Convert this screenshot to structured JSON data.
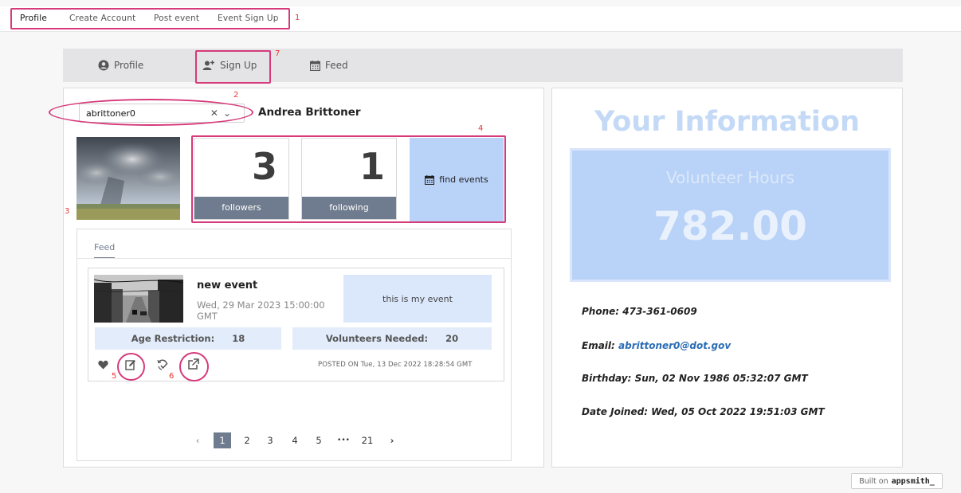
{
  "topnav": {
    "items": [
      "Profile",
      "Create Account",
      "Post event",
      "Event Sign Up"
    ],
    "active": "Profile"
  },
  "tabs": [
    "Profile",
    "Sign Up",
    "Feed"
  ],
  "user": {
    "select_value": "abrittoner0",
    "name": "Andrea Brittoner"
  },
  "stats": {
    "followers_count": "3",
    "followers_label": "followers",
    "following_count": "1",
    "following_label": "following",
    "find_events_label": "find events"
  },
  "feed": {
    "tab_label": "Feed",
    "event": {
      "title": "new event",
      "date": "Wed, 29 Mar 2023 15:00:00 GMT",
      "description": "this is my event",
      "age_label": "Age Restriction:",
      "age_value": "18",
      "volunteers_label": "Volunteers Needed:",
      "volunteers_value": "20",
      "posted_on": "POSTED ON Tue, 13 Dec 2022 18:28:54 GMT"
    },
    "pagination": {
      "prev": "‹",
      "pages": [
        "1",
        "2",
        "3",
        "4",
        "5",
        "•••",
        "21"
      ],
      "current": "1",
      "next": "›"
    }
  },
  "info": {
    "title": "Your Information",
    "hours_label": "Volunteer Hours",
    "hours_value": "782.00",
    "phone": "Phone: 473-361-0609",
    "email_label": "Email: ",
    "email_value": "abrittoner0@dot.gov",
    "birthday": "Birthday: Sun, 02 Nov 1986 05:32:07 GMT",
    "joined": "Date Joined: Wed, 05 Oct 2022 19:51:03 GMT"
  },
  "annotations": [
    "1",
    "2",
    "3",
    "4",
    "5",
    "6",
    "7"
  ],
  "footer": {
    "built_on": "Built on",
    "brand": "appsmith_"
  },
  "colors": {
    "accent": "#6f7b8e",
    "light_blue": "#b9d2f7",
    "annotation": "#d63a7a"
  }
}
